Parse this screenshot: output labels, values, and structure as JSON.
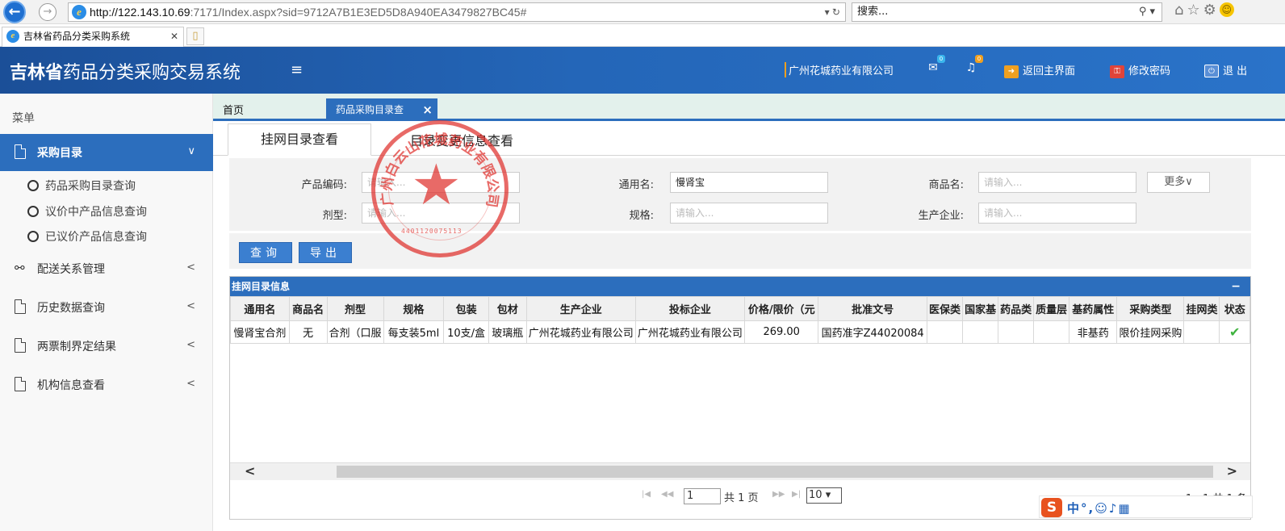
{
  "browser": {
    "url_host": "http://122.143.10.69",
    "url_rest": ":7171/Index.aspx?sid=9712A7B1E3ED5D8A940EA3479827BC45#",
    "search_text": "搜索...",
    "tab_title": "吉林省药品分类采购系统"
  },
  "header": {
    "logo_bold": "吉林省",
    "logo_rest": "药品分类采购交易系统",
    "company": "广州花城药业有限公司",
    "mail_badge": "0",
    "bell_badge": "0",
    "home_label": "返回主界面",
    "pwd_label": "修改密码",
    "logout_label": "退 出"
  },
  "sidebar": {
    "menu_title": "菜单",
    "active": "采购目录",
    "sub_items": [
      "药品采购目录查询",
      "议价中产品信息查询",
      "已议价产品信息查询"
    ],
    "items": [
      "配送关系管理",
      "历史数据查询",
      "两票制界定结果",
      "机构信息查看"
    ]
  },
  "page_tabs": {
    "home": "首页",
    "active": "药品采购目录查"
  },
  "sub_tabs": [
    "挂网目录查看",
    "目录变更信息查看"
  ],
  "form": {
    "labels": [
      "产品编码:",
      "通用名:",
      "商品名:",
      "剂型:",
      "规格:",
      "生产企业:"
    ],
    "placeholder": "请输入...",
    "generic_name_value": "慢肾宝",
    "more": "更多∨"
  },
  "buttons": {
    "query": "查询",
    "export": "导出"
  },
  "panel": {
    "title": "挂网目录信息",
    "columns": [
      "通用名",
      "商品名",
      "剂型",
      "规格",
      "包装",
      "包材",
      "生产企业",
      "投标企业",
      "价格/限价（元",
      "批准文号",
      "医保类",
      "国家基",
      "药品类",
      "质量层",
      "基药属性",
      "采购类型",
      "挂网类",
      "状态"
    ],
    "rows": [
      [
        "慢肾宝合剂",
        "无",
        "合剂（口服",
        "每支装5ml",
        "10支/盒",
        "玻璃瓶",
        "广州花城药业有限公司",
        "广州花城药业有限公司",
        "269.00",
        "国药准字Z44020084",
        "",
        "",
        "",
        "",
        "非基药",
        "限价挂网采购",
        "",
        ""
      ]
    ]
  },
  "pager": {
    "page": "1",
    "total_pages": "共 1 页",
    "size": "10",
    "count": "1 - 1   共 1 条"
  },
  "stamp": {
    "text": "广州白云山花城药业有限公司",
    "number": "4401120075113"
  },
  "ime": {
    "logo": "S",
    "items": "中°,☺♪▦"
  },
  "colors": {
    "header": "#2466b8",
    "accent": "#2c6ebd",
    "stamp": "#e0312d"
  }
}
